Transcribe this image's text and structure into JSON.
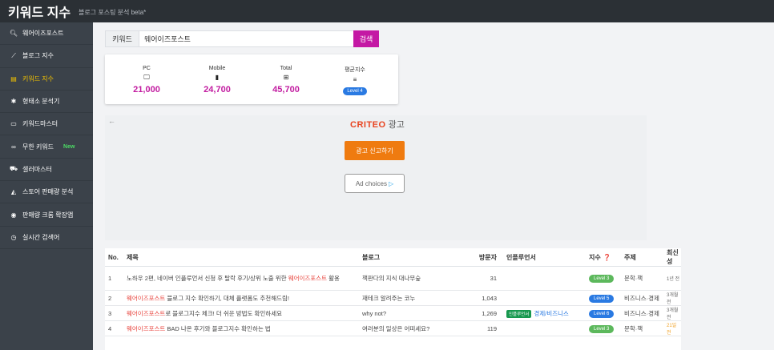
{
  "header": {
    "title": "키워드 지수",
    "subtitle": "블로그 포스팅 분석 beta*"
  },
  "sidebar": {
    "items": [
      {
        "label": "웨어이즈포스트",
        "icon": "search-icon",
        "active": false
      },
      {
        "label": "블로그 지수",
        "icon": "chart-line-icon",
        "active": false
      },
      {
        "label": "키워드 지수",
        "icon": "chart-bar-icon",
        "active": true
      },
      {
        "label": "형태소 분석기",
        "icon": "gear-icon",
        "active": false
      },
      {
        "label": "키워드마스터",
        "icon": "keyboard-icon",
        "active": false
      },
      {
        "label": "무한 키워드",
        "icon": "infinity-icon",
        "active": false,
        "badge": "New"
      },
      {
        "label": "셀러마스터",
        "icon": "cart-icon",
        "active": false
      },
      {
        "label": "스토어 판매량 분석",
        "icon": "area-chart-icon",
        "active": false
      },
      {
        "label": "판매량 크롬 확장앱",
        "icon": "chrome-icon",
        "active": false
      },
      {
        "label": "실시간 검색어",
        "icon": "clock-icon",
        "active": false
      }
    ]
  },
  "search": {
    "label": "키워드",
    "value": "웨어이즈포스트",
    "button": "검색"
  },
  "stats": {
    "pc": {
      "label": "PC",
      "value": "21,000"
    },
    "mobile": {
      "label": "Mobile",
      "value": "24,700"
    },
    "total": {
      "label": "Total",
      "value": "45,700"
    },
    "avg": {
      "label": "평균지수",
      "level": "Level 4"
    }
  },
  "ad": {
    "brand": "CRITEO",
    "brand_suffix": "광고",
    "report_button": "광고 신고하기",
    "choices_label": "Ad choices"
  },
  "table": {
    "headers": [
      "No.",
      "제목",
      "블로그",
      "방문자",
      "인플루언서",
      "지수",
      "주제",
      "최신성"
    ],
    "rows": [
      {
        "no": "1",
        "title_pre": "노하우 2편, 네이버 인플루언서 신청 후 탈락 후기/상위 노출 위한 ",
        "title_kw": "웨어이즈포스트",
        "title_post": " 활용",
        "blog": "책판다의 지식 대나무숲",
        "visitors": "31",
        "influencer": "",
        "infl_cat": "",
        "level": "Level 3",
        "level_color": "#5cb85c",
        "topic": "문학·책",
        "recent": "1년 전",
        "recent_highlight": false
      },
      {
        "no": "2",
        "title_pre": "",
        "title_kw": "웨어이즈포스트",
        "title_post": " 블로그 지수 확인하기, 대체 플랫폼도 추천해드림!",
        "blog": "재테크 알려주는 코누",
        "visitors": "1,043",
        "influencer": "",
        "infl_cat": "",
        "level": "Level 5",
        "level_color": "#2a7ae2",
        "topic": "비즈니스·경제",
        "recent": "3개월 전",
        "recent_highlight": false
      },
      {
        "no": "3",
        "title_pre": "",
        "title_kw": "웨어이즈포스트",
        "title_post": "로 블로그지수 체크! 더 쉬운 방법도 확인하세요",
        "blog": "why not?",
        "visitors": "1,269",
        "influencer": "인플루언서",
        "infl_cat": "경제/비즈니스",
        "level": "Level 6",
        "level_color": "#2a7ae2",
        "topic": "비즈니스·경제",
        "recent": "3개월 전",
        "recent_highlight": false
      },
      {
        "no": "4",
        "title_pre": "",
        "title_kw": "웨어이즈포스트",
        "title_post": " BAD 나온 후기와 블로그지수 확인하는 법",
        "blog": "여러분의 일상은 어떠세요?",
        "visitors": "119",
        "influencer": "",
        "infl_cat": "",
        "level": "Level 3",
        "level_color": "#5cb85c",
        "topic": "문학·책",
        "recent": "21일 전",
        "recent_highlight": true
      }
    ]
  }
}
